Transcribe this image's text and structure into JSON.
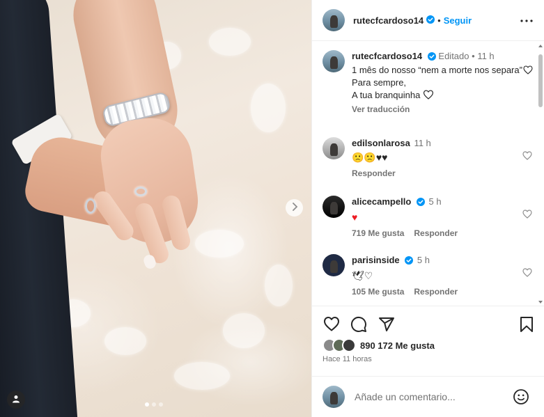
{
  "post": {
    "author": "rutecfcardoso14",
    "follow_label": "Seguir",
    "separator": "•",
    "caption": {
      "edited_label": "Editado",
      "time": "11 h",
      "line1": "1 mês do nosso “nem a morte nos separa”",
      "line2": "Para sempre,",
      "line3": "A tua branquinha",
      "translate_label": "Ver traducción"
    },
    "likes_text": "890 172 Me gusta",
    "time_ago": "Hace 11 horas",
    "comment_placeholder": "Añade un comentario...",
    "carousel": {
      "slides": 3,
      "active": 0
    }
  },
  "comments": [
    {
      "user": "edilsonlarosa",
      "time": "11 h",
      "text": "🙁🙁♥♥",
      "likes": "",
      "reply_label": "Responder",
      "verified": false
    },
    {
      "user": "alicecampello",
      "time": "5 h",
      "text": "♥",
      "likes": "719 Me gusta",
      "reply_label": "Responder",
      "verified": true
    },
    {
      "user": "parisinside",
      "time": "5 h",
      "text": "🕊♡",
      "likes": "105 Me gusta",
      "reply_label": "Responder",
      "verified": true
    }
  ],
  "colors": {
    "link_blue": "#0095f6",
    "verified_blue": "#0095f6",
    "heart_red": "#ed1c24",
    "muted": "#737373"
  },
  "icons": [
    "more-icon",
    "verified-icon",
    "heart-icon",
    "comment-icon",
    "share-icon",
    "bookmark-icon",
    "emoji-icon",
    "chevron-right-icon",
    "user-tag-icon"
  ]
}
